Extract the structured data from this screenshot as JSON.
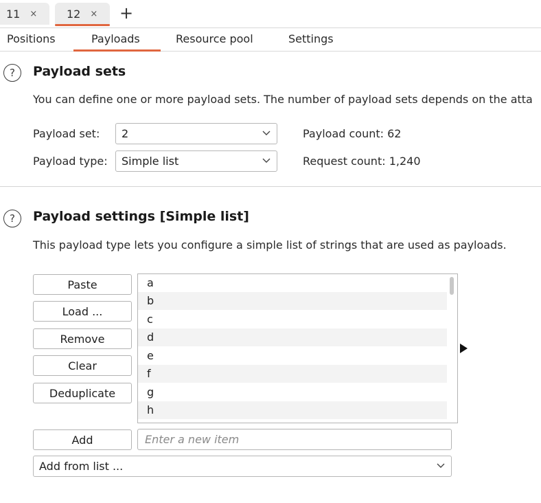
{
  "tabs": [
    {
      "label": "11",
      "close": "×"
    },
    {
      "label": "12",
      "close": "×"
    }
  ],
  "tab_add": "+",
  "subtabs": [
    "Positions",
    "Payloads",
    "Resource pool",
    "Settings"
  ],
  "payload_sets": {
    "title": "Payload sets",
    "description": "You can define one or more payload sets. The number of payload sets depends on the atta",
    "set_label": "Payload set:",
    "set_value": "2",
    "type_label": "Payload type:",
    "type_value": "Simple list",
    "count_label": "Payload count:",
    "count_value": "62",
    "request_label": "Request count:",
    "request_value": "1,240"
  },
  "payload_settings": {
    "title": "Payload settings [Simple list]",
    "description": "This payload type lets you configure a simple list of strings that are used as payloads.",
    "buttons": {
      "paste": "Paste",
      "load": "Load ...",
      "remove": "Remove",
      "clear": "Clear",
      "deduplicate": "Deduplicate",
      "add": "Add"
    },
    "items": [
      "a",
      "b",
      "c",
      "d",
      "e",
      "f",
      "g",
      "h"
    ],
    "new_item_placeholder": "Enter a new item",
    "add_from_list": "Add from list ..."
  },
  "icons": {
    "help": "help-circle-icon",
    "chevron": "chevron-down-icon",
    "arrow": "play-arrow-icon"
  },
  "colors": {
    "accent": "#e0663f"
  }
}
